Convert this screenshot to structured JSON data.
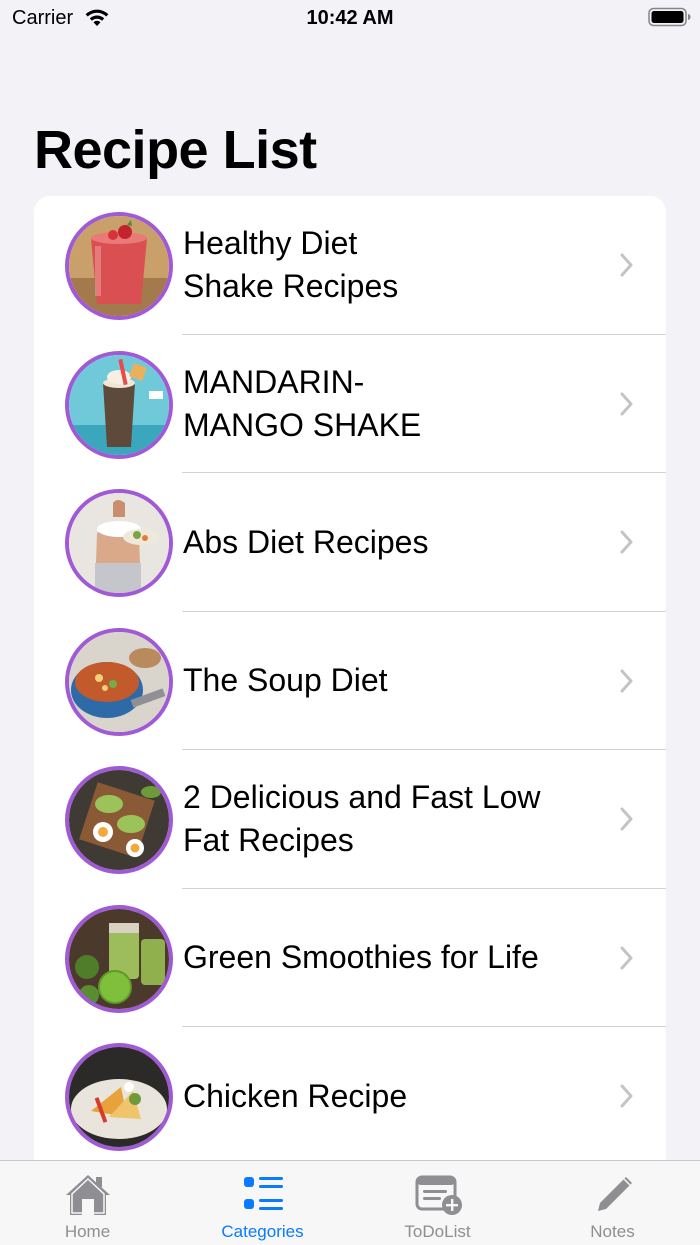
{
  "status_bar": {
    "carrier": "Carrier",
    "time": "10:42 AM"
  },
  "page": {
    "title": "Recipe List"
  },
  "recipes": [
    {
      "line1": "Healthy Diet",
      "line2": "Shake Recipes",
      "thumb": "strawberry-shake"
    },
    {
      "line1": "MANDARIN-",
      "line2": "MANGO SHAKE",
      "thumb": "mango-shake"
    },
    {
      "line1": "Abs Diet Recipes",
      "line2": "",
      "thumb": "abs-diet"
    },
    {
      "line1": "The Soup Diet",
      "line2": "",
      "thumb": "soup"
    },
    {
      "line1": "2 Delicious and Fast Low",
      "line2": "Fat Recipes",
      "thumb": "avocado-toast"
    },
    {
      "line1": "Green Smoothies for Life",
      "line2": "",
      "thumb": "green-smoothie"
    },
    {
      "line1": "Chicken Recipe",
      "line2": "",
      "thumb": "chicken"
    }
  ],
  "tab_bar": {
    "tabs": [
      {
        "label": "Home",
        "icon": "house-icon",
        "active": false
      },
      {
        "label": "Categories",
        "icon": "list-icon",
        "active": true
      },
      {
        "label": "ToDoList",
        "icon": "todo-add-icon",
        "active": false
      },
      {
        "label": "Notes",
        "icon": "pencil-icon",
        "active": false
      }
    ]
  },
  "colors": {
    "accent": "#0a7aff",
    "thumb_border": "#a15ad6",
    "inactive_tab": "#8e8e93",
    "background": "#f2f2f7"
  }
}
